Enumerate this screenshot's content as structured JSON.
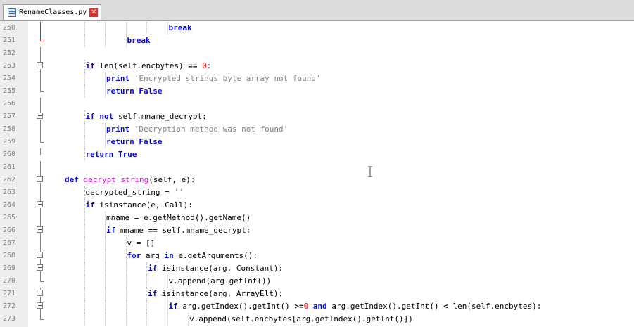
{
  "tab": {
    "title": "RenameClasses.py",
    "close": "✕"
  },
  "colors": {
    "keyword": "#0000ff",
    "function": "#ff00ff",
    "string": "#808080",
    "number": "#ff0000",
    "fold_changed": "#e02020"
  },
  "lines": [
    {
      "num": "250",
      "indent": 6,
      "fold": "red",
      "tokens": [
        {
          "t": "break",
          "c": "kw"
        }
      ]
    },
    {
      "num": "251",
      "indent": 4,
      "fold": "red-end",
      "tokens": [
        {
          "t": "break",
          "c": "kw"
        }
      ]
    },
    {
      "num": "252",
      "indent": 0,
      "fold": "line",
      "tokens": []
    },
    {
      "num": "253",
      "indent": 2,
      "fold": "box",
      "tokens": [
        {
          "t": "if",
          "c": "kw"
        },
        {
          "t": " len(self.encbytes) "
        },
        {
          "t": "==",
          "c": "op"
        },
        {
          "t": " "
        },
        {
          "t": "0",
          "c": "num"
        },
        {
          "t": ":"
        }
      ]
    },
    {
      "num": "254",
      "indent": 3,
      "fold": "line",
      "tokens": [
        {
          "t": "print",
          "c": "kw"
        },
        {
          "t": " "
        },
        {
          "t": "'Encrypted strings byte array not found'",
          "c": "str"
        }
      ]
    },
    {
      "num": "255",
      "indent": 3,
      "fold": "end",
      "tokens": [
        {
          "t": "return",
          "c": "kw"
        },
        {
          "t": " "
        },
        {
          "t": "False",
          "c": "kw"
        }
      ]
    },
    {
      "num": "256",
      "indent": 0,
      "fold": "line",
      "tokens": []
    },
    {
      "num": "257",
      "indent": 2,
      "fold": "box",
      "tokens": [
        {
          "t": "if",
          "c": "kw"
        },
        {
          "t": " "
        },
        {
          "t": "not",
          "c": "kw"
        },
        {
          "t": " self.mname_decrypt:"
        }
      ]
    },
    {
      "num": "258",
      "indent": 3,
      "fold": "line",
      "tokens": [
        {
          "t": "print",
          "c": "kw"
        },
        {
          "t": " "
        },
        {
          "t": "'Decryption method was not found'",
          "c": "str"
        }
      ]
    },
    {
      "num": "259",
      "indent": 3,
      "fold": "end",
      "tokens": [
        {
          "t": "return",
          "c": "kw"
        },
        {
          "t": " "
        },
        {
          "t": "False",
          "c": "kw"
        }
      ]
    },
    {
      "num": "260",
      "indent": 2,
      "fold": "end",
      "tokens": [
        {
          "t": "return",
          "c": "kw"
        },
        {
          "t": " "
        },
        {
          "t": "True",
          "c": "kw"
        }
      ]
    },
    {
      "num": "261",
      "indent": 0,
      "fold": "line",
      "tokens": []
    },
    {
      "num": "262",
      "indent": 1,
      "fold": "box",
      "tokens": [
        {
          "t": "def",
          "c": "kw"
        },
        {
          "t": " "
        },
        {
          "t": "decrypt_string",
          "c": "fn"
        },
        {
          "t": "(self, e):"
        }
      ]
    },
    {
      "num": "263",
      "indent": 2,
      "fold": "line",
      "tokens": [
        {
          "t": "decrypted_string = "
        },
        {
          "t": "''",
          "c": "str"
        }
      ]
    },
    {
      "num": "264",
      "indent": 2,
      "fold": "box",
      "tokens": [
        {
          "t": "if",
          "c": "kw"
        },
        {
          "t": " isinstance(e, Call):"
        }
      ]
    },
    {
      "num": "265",
      "indent": 3,
      "fold": "line",
      "tokens": [
        {
          "t": "mname = e.getMethod().getName()"
        }
      ]
    },
    {
      "num": "266",
      "indent": 3,
      "fold": "box",
      "tokens": [
        {
          "t": "if",
          "c": "kw"
        },
        {
          "t": " mname "
        },
        {
          "t": "==",
          "c": "op"
        },
        {
          "t": " self.mname_decrypt:"
        }
      ]
    },
    {
      "num": "267",
      "indent": 4,
      "fold": "line",
      "tokens": [
        {
          "t": "v = []"
        }
      ]
    },
    {
      "num": "268",
      "indent": 4,
      "fold": "box",
      "tokens": [
        {
          "t": "for",
          "c": "kw"
        },
        {
          "t": " arg "
        },
        {
          "t": "in",
          "c": "kw"
        },
        {
          "t": " e.getArguments():"
        }
      ]
    },
    {
      "num": "269",
      "indent": 5,
      "fold": "box",
      "tokens": [
        {
          "t": "if",
          "c": "kw"
        },
        {
          "t": " isinstance(arg, Constant):"
        }
      ]
    },
    {
      "num": "270",
      "indent": 6,
      "fold": "end",
      "tokens": [
        {
          "t": "v.append(arg.getInt())"
        }
      ]
    },
    {
      "num": "271",
      "indent": 5,
      "fold": "box",
      "tokens": [
        {
          "t": "if",
          "c": "kw"
        },
        {
          "t": " isinstance(arg, ArrayElt):"
        }
      ]
    },
    {
      "num": "272",
      "indent": 6,
      "fold": "box",
      "tokens": [
        {
          "t": "if",
          "c": "kw"
        },
        {
          "t": " arg.getIndex().getInt() "
        },
        {
          "t": ">=",
          "c": "op"
        },
        {
          "t": "0",
          "c": "num"
        },
        {
          "t": " "
        },
        {
          "t": "and",
          "c": "kw"
        },
        {
          "t": " arg.getIndex().getInt() "
        },
        {
          "t": "<",
          "c": "op"
        },
        {
          "t": " len(self.encbytes):"
        }
      ]
    },
    {
      "num": "273",
      "indent": 7,
      "fold": "end",
      "tokens": [
        {
          "t": "v.append(self.encbytes[arg.getIndex().getInt()])"
        }
      ]
    }
  ]
}
